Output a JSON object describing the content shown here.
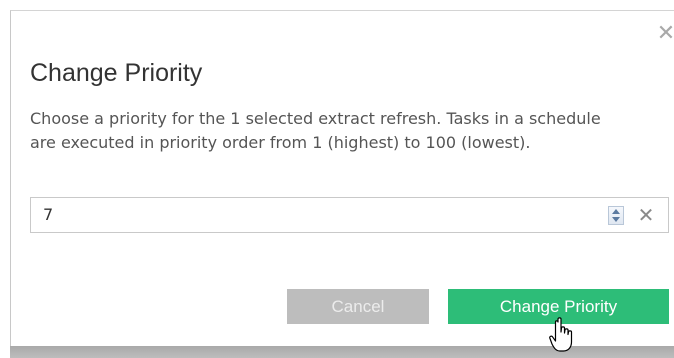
{
  "dialog": {
    "title": "Change Priority",
    "description": "Choose a priority for the 1 selected extract refresh. Tasks in a schedule are executed in priority order from 1 (highest) to 100 (lowest).",
    "close_icon": "close-icon",
    "close_glyph": "✕"
  },
  "priority_input": {
    "value": "7",
    "spinner_icon": "spinner-icon",
    "clear_icon": "clear-icon",
    "clear_glyph": "✕"
  },
  "buttons": {
    "cancel_label": "Cancel",
    "confirm_label": "Change Priority"
  },
  "colors": {
    "primary": "#2dbd78",
    "cancel_disabled": "#bdbdbd",
    "title_text": "#333333",
    "body_text": "#555555"
  }
}
